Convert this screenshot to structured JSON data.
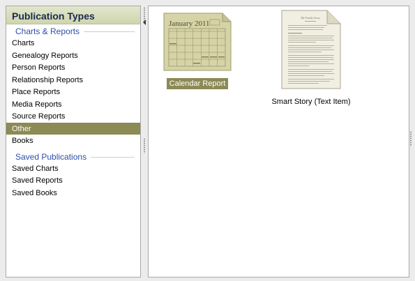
{
  "left_panel": {
    "title": "Publication Types",
    "sections": [
      {
        "header": "Charts & Reports",
        "items": [
          {
            "label": "Charts"
          },
          {
            "label": "Genealogy Reports"
          },
          {
            "label": "Person Reports"
          },
          {
            "label": "Relationship Reports"
          },
          {
            "label": "Place Reports"
          },
          {
            "label": "Media Reports"
          },
          {
            "label": "Source Reports"
          },
          {
            "label": "Other",
            "selected": true
          },
          {
            "label": "Books"
          }
        ]
      },
      {
        "header": "Saved Publications",
        "items": [
          {
            "label": "Saved Charts"
          },
          {
            "label": "Saved Reports"
          },
          {
            "label": "Saved Books"
          }
        ]
      }
    ]
  },
  "main": {
    "items": [
      {
        "label": "Calendar Report",
        "thumbnail_text": "January 2011",
        "selected": true,
        "icon": "calendar-report-icon"
      },
      {
        "label": "Smart Story (Text Item)",
        "thumbnail_text": "My Family Story",
        "selected": false,
        "icon": "smart-story-icon"
      }
    ]
  },
  "colors": {
    "selection": "#8c8a55",
    "section_header_text": "#2e4fa8",
    "header_bg": "#cfd5ae",
    "calendar_bg": "#d6d4a6"
  }
}
